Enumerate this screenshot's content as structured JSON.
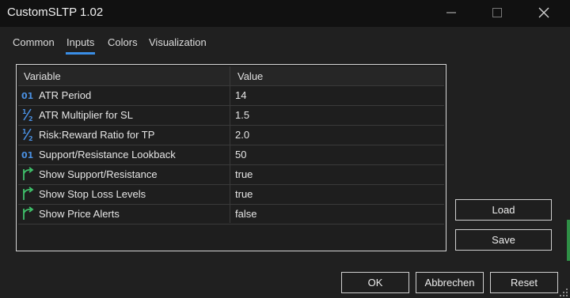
{
  "window": {
    "title": "CustomSLTP 1.02",
    "controls": [
      "minimize-icon",
      "maximize-icon",
      "close-icon"
    ]
  },
  "tabs": [
    {
      "label": "Common",
      "active": false
    },
    {
      "label": "Inputs",
      "active": true
    },
    {
      "label": "Colors",
      "active": false
    },
    {
      "label": "Visualization",
      "active": false
    }
  ],
  "table": {
    "headers": {
      "variable": "Variable",
      "value": "Value"
    },
    "rows": [
      {
        "icon": "integer-icon",
        "variable": "ATR Period",
        "value": "14"
      },
      {
        "icon": "fraction-icon",
        "variable": "ATR Multiplier for SL",
        "value": "1.5"
      },
      {
        "icon": "fraction-icon",
        "variable": "Risk:Reward Ratio for TP",
        "value": "2.0"
      },
      {
        "icon": "integer-icon",
        "variable": "Support/Resistance Lookback",
        "value": "50"
      },
      {
        "icon": "boolean-arrow-icon",
        "variable": "Show Support/Resistance",
        "value": "true"
      },
      {
        "icon": "boolean-arrow-icon",
        "variable": "Show Stop Loss Levels",
        "value": "true"
      },
      {
        "icon": "boolean-arrow-icon",
        "variable": "Show Price Alerts",
        "value": "false"
      }
    ]
  },
  "side_buttons": {
    "load": "Load",
    "save": "Save"
  },
  "footer_buttons": {
    "ok": "OK",
    "cancel": "Abbrechen",
    "reset": "Reset"
  },
  "colors": {
    "background": "#202020",
    "titlebar": "#111111",
    "accent": "#3a8ee6",
    "icon_blue": "#4a8fe0",
    "icon_green": "#3fbf6a"
  }
}
